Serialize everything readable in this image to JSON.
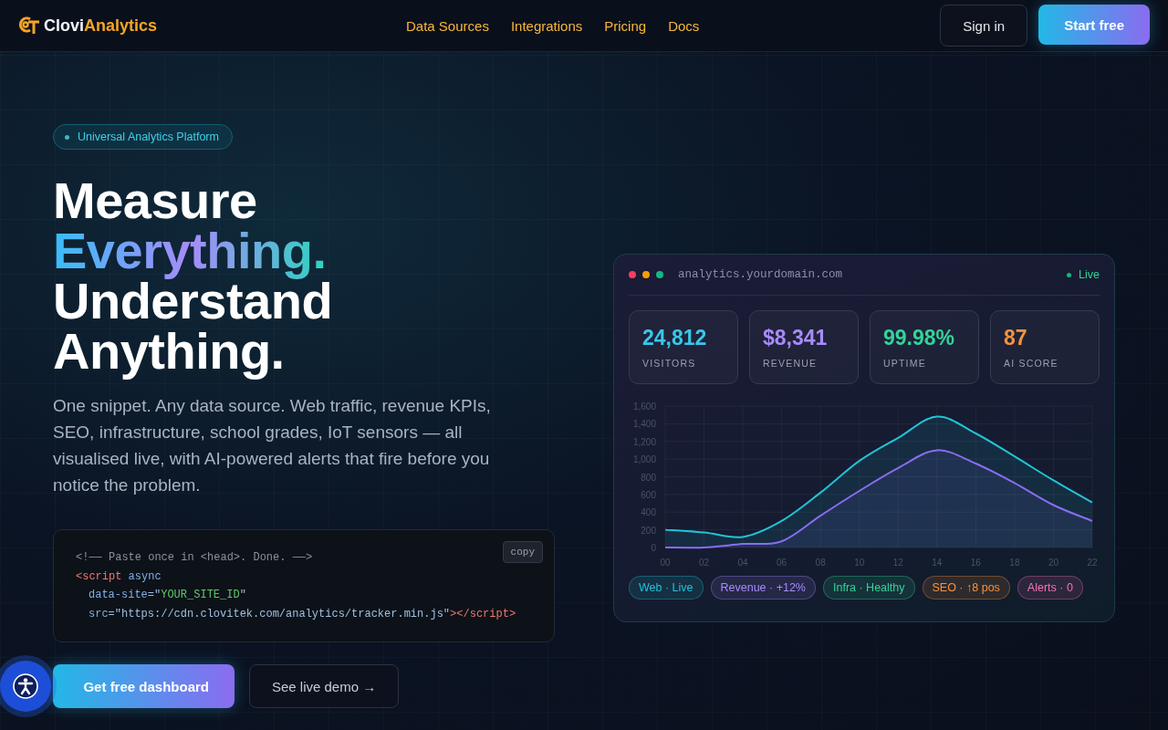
{
  "header": {
    "logo": {
      "parts": [
        "Clovi",
        "Analytics"
      ]
    },
    "nav": [
      "Data Sources",
      "Integrations",
      "Pricing",
      "Docs"
    ],
    "sign_in": "Sign in",
    "start": "Start free"
  },
  "hero": {
    "badge": "Universal Analytics Platform",
    "headline": [
      {
        "text": "Measure",
        "gradient": false
      },
      {
        "text": "Everything.",
        "gradient": true
      },
      {
        "text": "Understand",
        "gradient": false
      },
      {
        "text": "Anything.",
        "gradient": false
      }
    ],
    "description": "One snippet. Any data source. Web traffic, revenue KPIs, SEO, infrastructure, school grades, IoT sensors — all visualised live, with AI-powered alerts that fire before you notice the problem.",
    "snippet": {
      "copy": "copy",
      "lines": [
        [
          {
            "kind": "comment",
            "text": "<!—— Paste once in <head>. Done. ——>"
          }
        ],
        [
          {
            "kind": "tag",
            "text": "<script"
          },
          {
            "kind": "attr",
            "text": " async"
          }
        ],
        [
          {
            "kind": "indent"
          },
          {
            "kind": "attr",
            "text": "data-site"
          },
          {
            "kind": "plain",
            "text": "=\""
          },
          {
            "kind": "string",
            "text": "YOUR_SITE_ID"
          },
          {
            "kind": "plain",
            "text": "\""
          }
        ],
        [
          {
            "kind": "indent"
          },
          {
            "kind": "attr",
            "text": "src"
          },
          {
            "kind": "plain",
            "text": "=\"https://cdn.clovitek.com/analytics/tracker.min.js\""
          },
          {
            "kind": "tag",
            "text": "></script>"
          }
        ]
      ]
    },
    "primary": "Get free dashboard",
    "secondary": "See live demo →"
  },
  "dashboard": {
    "url": "analytics.yourdomain.com",
    "status": "Live",
    "stats": [
      {
        "value": "24,812",
        "label": "VISITORS",
        "color": "#38c8e8"
      },
      {
        "value": "$8,341",
        "label": "REVENUE",
        "color": "#a78bfa"
      },
      {
        "value": "99.98%",
        "label": "UPTIME",
        "color": "#34d399"
      },
      {
        "value": "87",
        "label": "AI SCORE",
        "color": "#fb923c"
      }
    ],
    "chart_data": {
      "type": "area",
      "stacked": false,
      "grid": true,
      "categories": [
        "00",
        "02",
        "04",
        "06",
        "08",
        "10",
        "12",
        "14",
        "16",
        "18",
        "20",
        "22"
      ],
      "series": [
        {
          "color": "#22c3d6",
          "values": [
            200,
            170,
            120,
            300,
            620,
            980,
            1240,
            1480,
            1290,
            1030,
            760,
            510
          ]
        },
        {
          "color": "#8b6cf0",
          "values": [
            0,
            0,
            40,
            70,
            360,
            640,
            900,
            1100,
            950,
            730,
            480,
            300
          ]
        }
      ],
      "ylim": [
        0,
        1600
      ],
      "yticks": [
        0,
        200,
        400,
        600,
        800,
        {
          "value": 1000,
          "label": "1,000"
        },
        {
          "value": 1200,
          "label": "1,200"
        },
        {
          "value": 1400,
          "label": "1,400"
        },
        {
          "value": 1600,
          "label": "1,600"
        }
      ]
    },
    "pills": [
      {
        "text": "Web · Live",
        "color": "#22c3d6"
      },
      {
        "text": "Revenue · +12%",
        "color": "#a78bfa"
      },
      {
        "text": "Infra · Healthy",
        "color": "#34d399"
      },
      {
        "text": "SEO · ↑8 pos",
        "color": "#fb923c"
      },
      {
        "text": "Alerts · 0",
        "color": "#f472b6"
      }
    ]
  }
}
